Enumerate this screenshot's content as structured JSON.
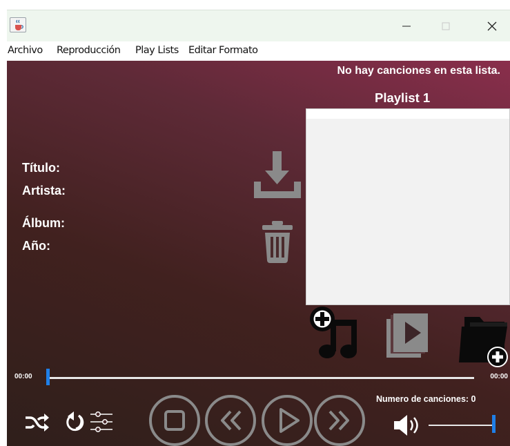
{
  "window": {
    "icon": "java-cup-icon",
    "controls": {
      "minimize": "minimize-icon",
      "maximize": "maximize-icon",
      "close": "close-icon"
    }
  },
  "menu": {
    "items": [
      "Archivo",
      "Reproducción",
      "Play Lists",
      "Editar Formato"
    ]
  },
  "playlist": {
    "empty_message": "No hay canciones en esta lista.",
    "name": "Playlist 1",
    "songs": [],
    "count_label": "Numero de canciones: 0"
  },
  "song_info": {
    "title_label": "Título:",
    "artist_label": "Artista:",
    "album_label": "Álbum:",
    "year_label": "Año:"
  },
  "player": {
    "current_time": "00:00",
    "total_time": "00:00",
    "progress": 0,
    "volume": 1.0
  },
  "icons": {
    "download": "download-icon",
    "delete": "trash-icon",
    "add_song": "add-music-icon",
    "play_playlist": "playlist-play-icon",
    "add_folder": "add-folder-icon",
    "shuffle": "shuffle-icon",
    "repeat": "repeat-icon",
    "equalizer": "equalizer-icon",
    "stop": "stop-icon",
    "previous": "previous-icon",
    "play": "play-icon",
    "next": "next-icon",
    "volume": "volume-icon"
  },
  "colors": {
    "accent": "#1f7fe8",
    "inactive_icon": "#8a8a8a",
    "text": "#ffffff"
  }
}
